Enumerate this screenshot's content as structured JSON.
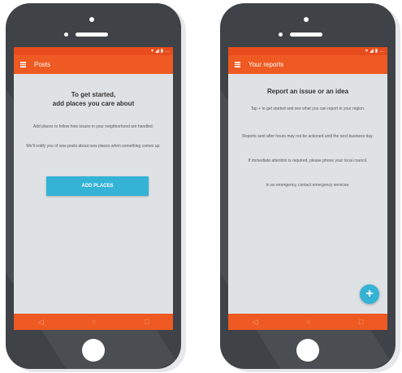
{
  "colors": {
    "accent": "#ee5a22",
    "status_bar": "#e84c1c",
    "button": "#34b3d6",
    "screen_bg": "#dfe2e5",
    "phone_body": "#3f4247"
  },
  "left": {
    "status_icons": [
      "▾",
      "◢",
      "▮",
      "…"
    ],
    "appbar": {
      "menu_icon": "menu-icon",
      "title": "Posts"
    },
    "headline_line1": "To get started,",
    "headline_line2": "add places you care about",
    "para1": "Add places to follow how issues in your neighborhood are handled.",
    "para2": "We'll notify you of new posts about new places when something comes up.",
    "cta_label": "ADD PLACES",
    "nav": {
      "back_icon": "◁",
      "home_icon": "○",
      "recents_icon": "□"
    }
  },
  "right": {
    "status_icons": [
      "▾",
      "◢",
      "▮",
      "…"
    ],
    "appbar": {
      "menu_icon": "menu-icon",
      "title": "Your reports"
    },
    "headline": "Report an issue or an idea",
    "para1": "Tap + to get started and see what you can report in your region.",
    "para2": "Reports sent after hours may not be actioned until the next business day.",
    "para3": "If immediate attention is required, please phone your local council.",
    "para4": "In an emergency, contact emergency services.",
    "fab_label": "+",
    "nav": {
      "back_icon": "◁",
      "home_icon": "○",
      "recents_icon": "□"
    }
  }
}
